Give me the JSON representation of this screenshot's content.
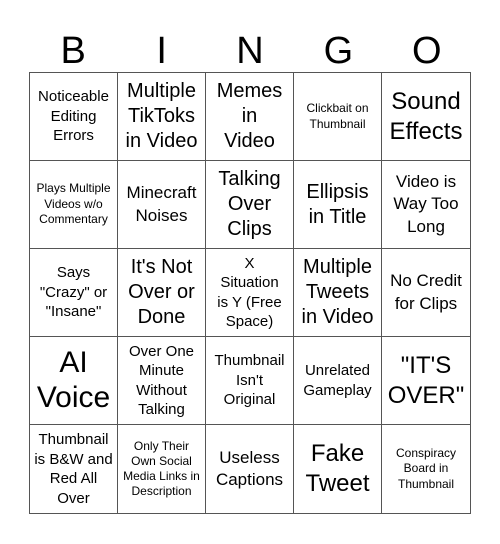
{
  "header": {
    "letters": [
      "B",
      "I",
      "N",
      "G",
      "O"
    ]
  },
  "board": {
    "rows": [
      [
        {
          "text": "Noticeable Editing Errors"
        },
        {
          "text": "Multiple TikToks in Video"
        },
        {
          "text": "Memes in Video"
        },
        {
          "text": "Clickbait on Thumbnail"
        },
        {
          "text": "Sound Effects"
        }
      ],
      [
        {
          "text": "Plays Multiple Videos w/o Commentary"
        },
        {
          "text": "Minecraft Noises"
        },
        {
          "text": "Talking Over Clips"
        },
        {
          "text": "Ellipsis in Title"
        },
        {
          "text": "Video is Way Too Long"
        }
      ],
      [
        {
          "text": "Says \"Crazy\" or \"Insane\""
        },
        {
          "text": "It's Not Over or Done"
        },
        {
          "text": "X Situation is Y (Free Space)",
          "free_space": true
        },
        {
          "text": "Multiple Tweets in Video"
        },
        {
          "text": "No Credit for Clips"
        }
      ],
      [
        {
          "text": "AI Voice"
        },
        {
          "text": "Over One Minute Without Talking"
        },
        {
          "text": "Thumbnail Isn't Original"
        },
        {
          "text": "Unrelated Gameplay"
        },
        {
          "text": "\"IT'S OVER\""
        }
      ],
      [
        {
          "text": "Thumbnail is B&W and Red All Over"
        },
        {
          "text": "Only Their Own Social Media Links in Description"
        },
        {
          "text": "Useless Captions"
        },
        {
          "text": "Fake Tweet"
        },
        {
          "text": "Conspiracy Board in Thumbnail"
        }
      ]
    ]
  }
}
